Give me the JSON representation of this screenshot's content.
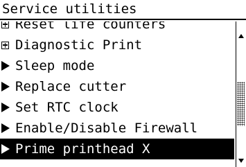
{
  "title": "Service utilities",
  "menu": {
    "items": [
      {
        "label": "Reset life counters",
        "marker": "plus-box-icon",
        "selected": false,
        "clipped": true
      },
      {
        "label": "Diagnostic Print",
        "marker": "plus-box-icon",
        "selected": false
      },
      {
        "label": "Sleep mode",
        "marker": "triangle-right-icon",
        "selected": false
      },
      {
        "label": "Replace cutter",
        "marker": "triangle-right-icon",
        "selected": false
      },
      {
        "label": "Set RTC clock",
        "marker": "triangle-right-icon",
        "selected": false
      },
      {
        "label": "Enable/Disable Firewall",
        "marker": "triangle-right-icon",
        "selected": false
      },
      {
        "label": "Prime printhead X",
        "marker": "triangle-right-icon",
        "selected": true
      }
    ]
  },
  "scrollbar": {
    "position_fraction": 0.7,
    "visible_fraction": 0.45
  }
}
